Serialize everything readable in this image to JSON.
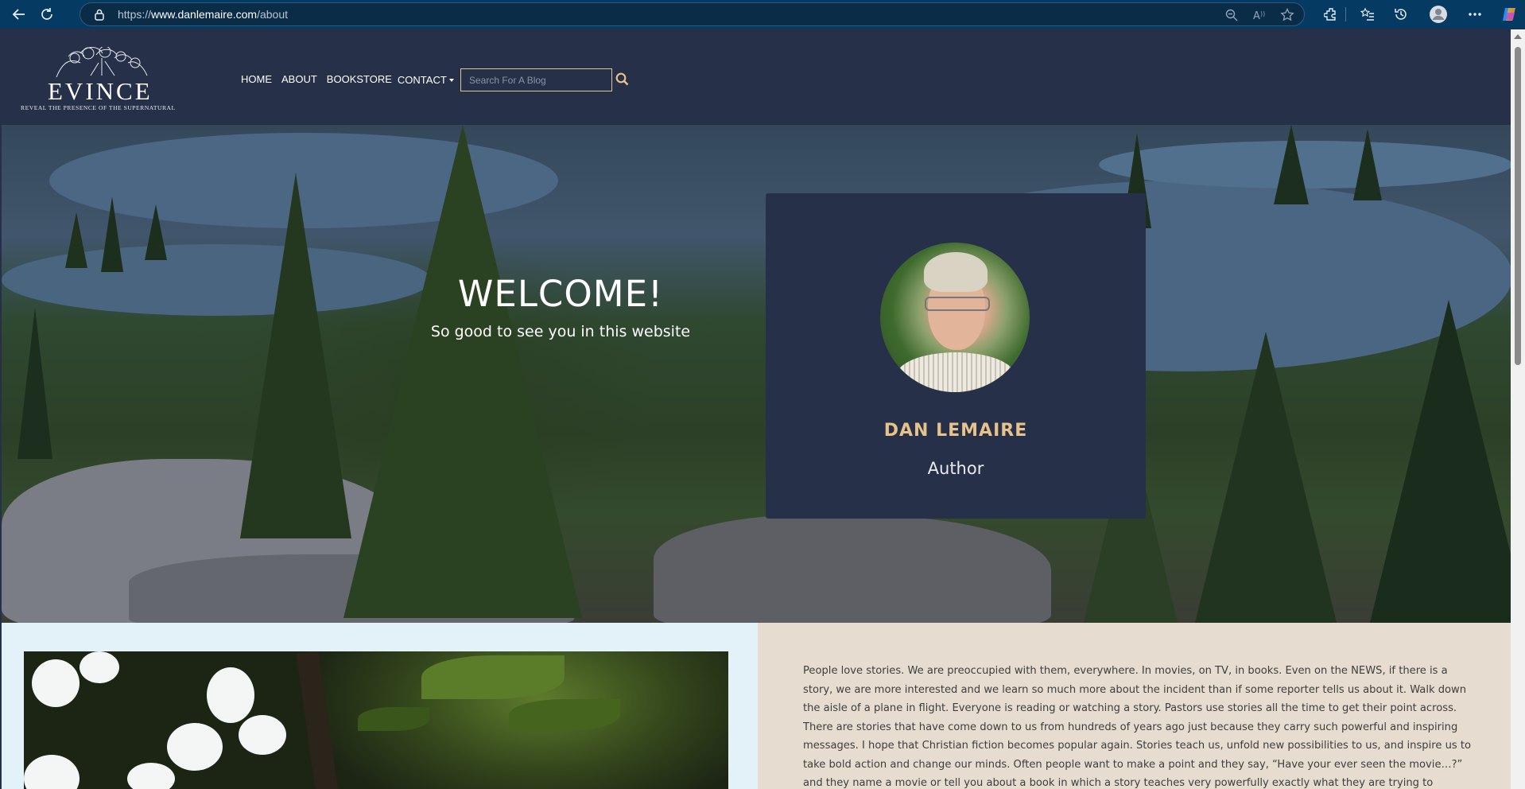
{
  "browser": {
    "url_scheme": "https://",
    "url_domain": "www.danlemaire.com",
    "url_path": "/about"
  },
  "header": {
    "logo_title": "EVINCE",
    "logo_tagline": "REVEAL THE PRESENCE OF THE SUPERNATURAL",
    "nav": {
      "home": "HOME",
      "about": "ABOUT",
      "bookstore": "BOOKSTORE",
      "contact": "CONTACT"
    },
    "search_placeholder": "Search For A Blog"
  },
  "hero": {
    "title": "WELCOME!",
    "subtitle": "So good to see you in this website"
  },
  "profile": {
    "name": "DAN LEMAIRE",
    "role": "Author"
  },
  "about": {
    "paragraph": "People love stories. We are preoccupied with them, everywhere. In movies, on TV, in books. Even on the NEWS, if there is a story, we are more interested and we learn so much more about the incident than if some reporter tells us about it. Walk down the aisle of a plane in flight. Everyone is reading or watching a story. Pastors use stories all the time to get their point across. There are stories that have come down to us from hundreds of years ago just because they carry such powerful and inspiring messages. I hope that Christian fiction becomes popular again. Stories teach us, unfold new possibilities to us, and inspire us to take bold action and change our minds. Often people want to make a point and they say, “Have your ever seen the movie…?” and they name a movie or tell you about a book in which a story teaches very powerfully exactly what they are trying to explain. And, chances are, if you watch"
  },
  "colors": {
    "header_bg": "#263048",
    "accent_gold": "#e6c38b",
    "lower_left_bg": "#e3f1f8",
    "lower_right_bg": "#e6dccf"
  }
}
